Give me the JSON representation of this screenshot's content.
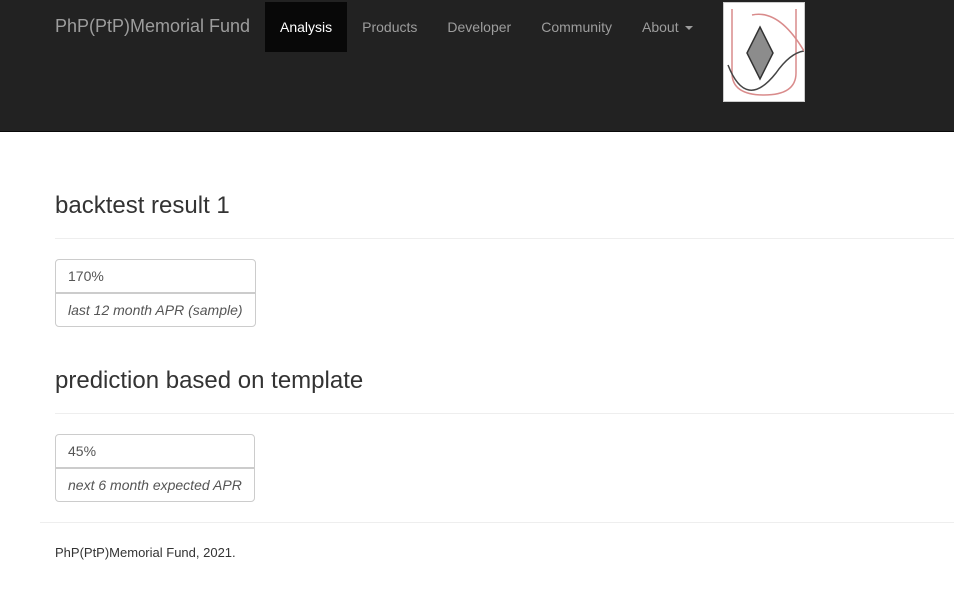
{
  "navbar": {
    "brand": "PhP(PtP)Memorial Fund",
    "items": [
      {
        "label": "Analysis",
        "active": true
      },
      {
        "label": "Products",
        "active": false
      },
      {
        "label": "Developer",
        "active": false
      },
      {
        "label": "Community",
        "active": false
      },
      {
        "label": "About",
        "active": false,
        "dropdown": true
      }
    ],
    "logo_icon": "diamond-logo-icon",
    "colors": {
      "background": "#222222",
      "active_bg": "#080808",
      "link": "#9d9d9d",
      "active_link": "#ffffff"
    }
  },
  "sections": [
    {
      "title": "backtest result 1",
      "value": "170%",
      "caption": "last 12 month APR (sample)"
    },
    {
      "title": "prediction based on template",
      "value": "45%",
      "caption": "next 6 month expected APR"
    }
  ],
  "footer": {
    "text": "PhP(PtP)Memorial Fund, 2021."
  }
}
